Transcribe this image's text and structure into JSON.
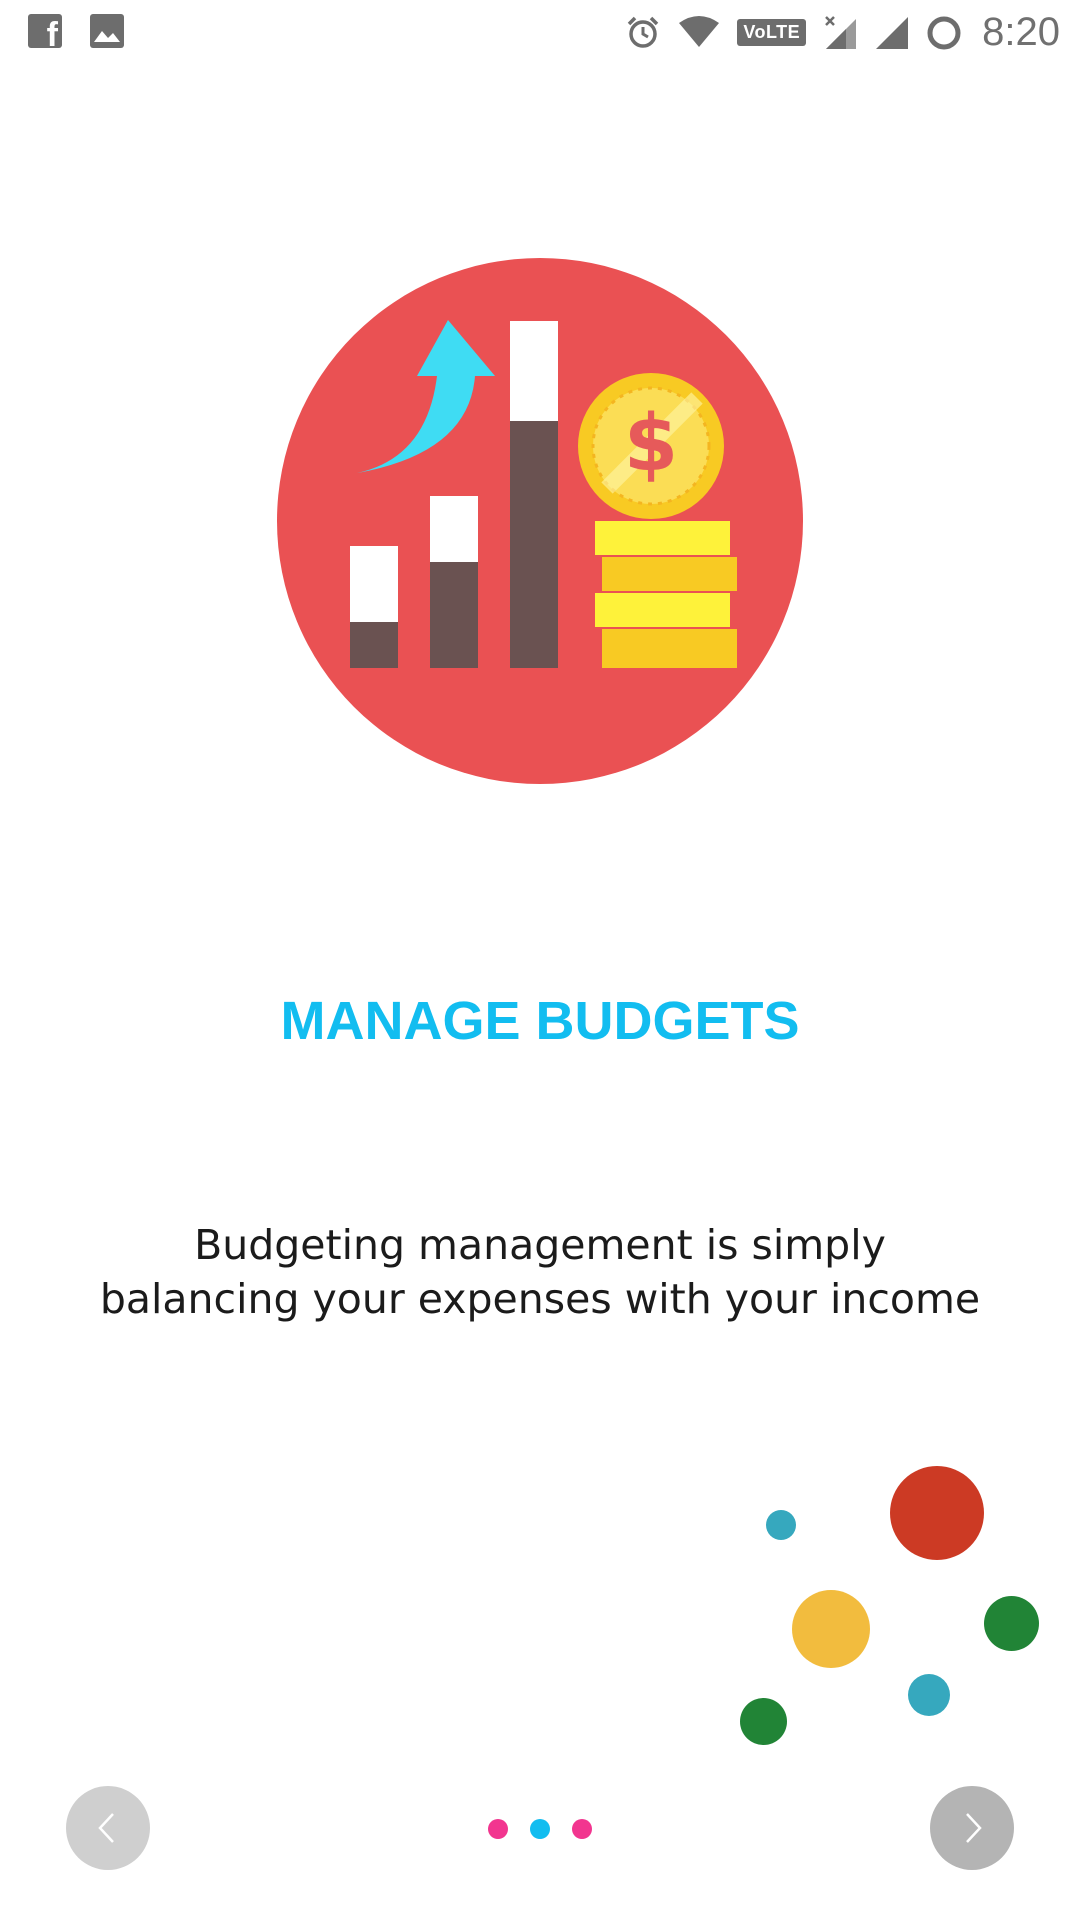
{
  "status_bar": {
    "time": "8:20",
    "volte_label": "VoLTE",
    "left_icons": [
      "facebook-icon",
      "gallery-icon"
    ],
    "right_icons": [
      "alarm-icon",
      "wifi-icon",
      "volte-icon",
      "no-sim-signal-icon",
      "signal-icon",
      "battery-icon"
    ]
  },
  "onboarding": {
    "illustration": "budget-growth-illustration",
    "dollar_symbol": "$",
    "title": "MANAGE BUDGETS",
    "description": "Budgeting management is simply balancing your expenses with your income"
  },
  "colors": {
    "title": "#12bdf0",
    "illustration_bg": "#ea5153",
    "pager_active": "#12bdf0",
    "pager_inactive": "#f2358f",
    "deco_red": "#cc3a24",
    "deco_yellow": "#f2bc3e",
    "deco_green": "#218436",
    "deco_teal": "#36a8be"
  },
  "pager": {
    "count": 3,
    "active_index": 1
  },
  "navigation": {
    "prev_icon": "chevron-left-icon",
    "next_icon": "chevron-right-icon"
  }
}
